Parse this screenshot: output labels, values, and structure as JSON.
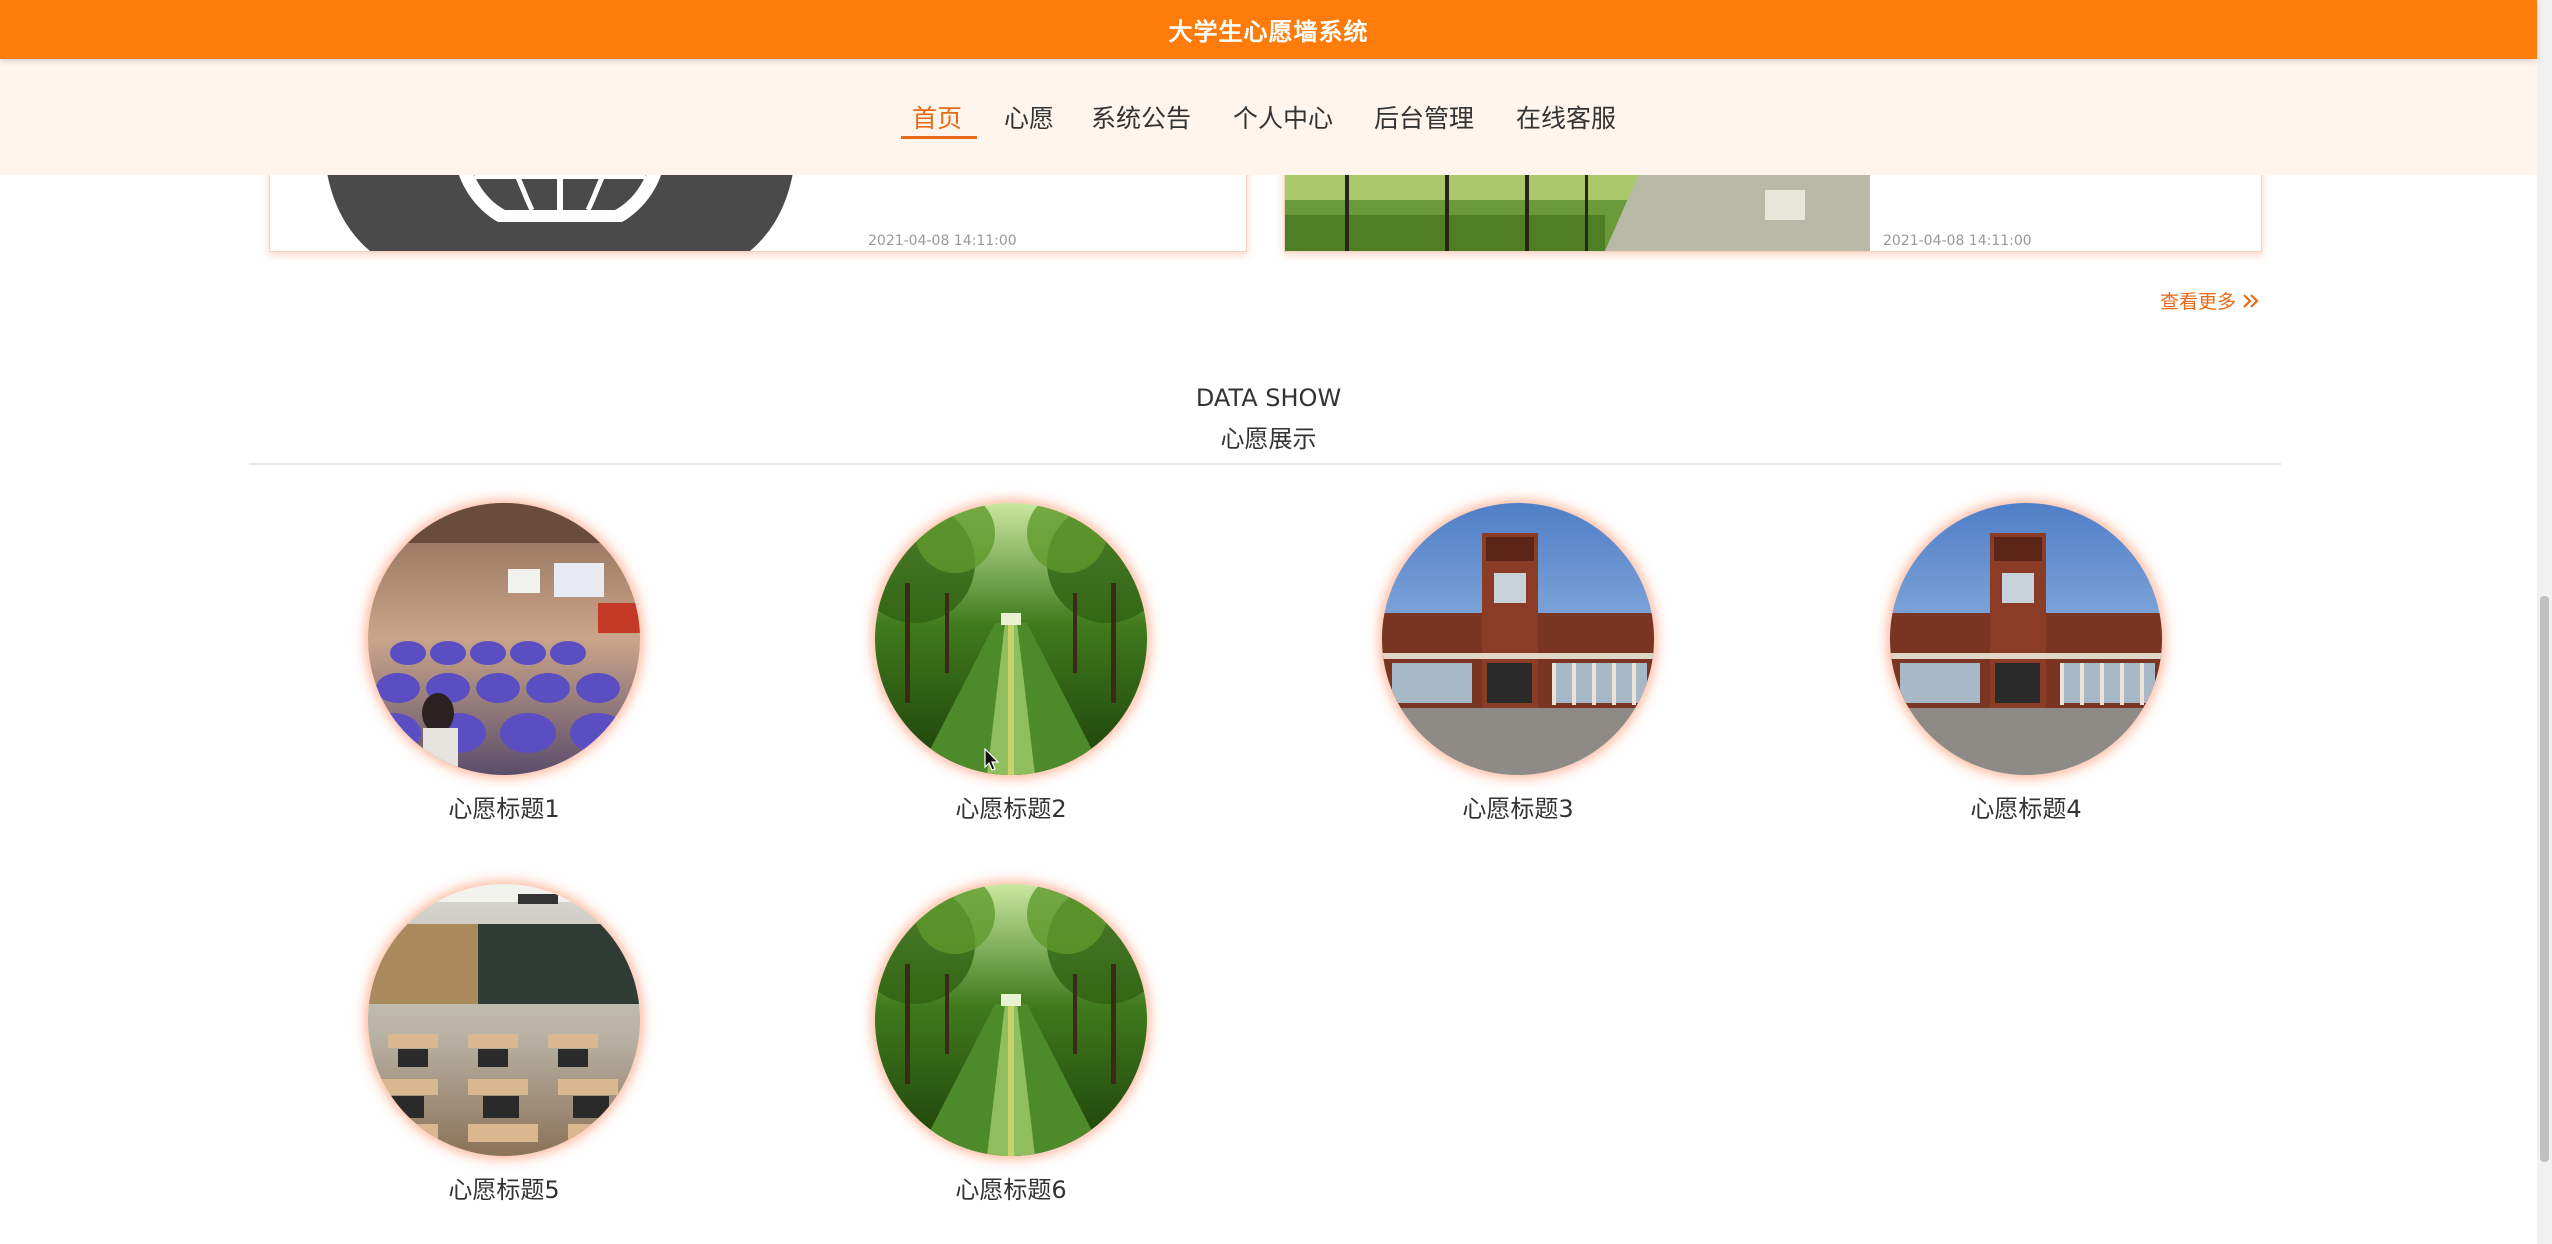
{
  "app": {
    "title": "大学生心愿墙系统"
  },
  "nav": {
    "items": [
      {
        "label": "首页",
        "active": true
      },
      {
        "label": "心愿",
        "active": false
      },
      {
        "label": "系统公告",
        "active": false
      },
      {
        "label": "个人中心",
        "active": false
      },
      {
        "label": "后台管理",
        "active": false
      },
      {
        "label": "在线客服",
        "active": false
      }
    ]
  },
  "news": {
    "cards": [
      {
        "date": "2021-04-08 14:11:00",
        "image": "globe-logo-image"
      },
      {
        "date": "2021-04-08 14:11:00",
        "image": "campus-path-image"
      }
    ],
    "more_label": "查看更多",
    "more_icon": "double-chevron-right-icon"
  },
  "section": {
    "title_en": "DATA SHOW",
    "title_cn": "心愿展示"
  },
  "wishes": [
    {
      "title": "心愿标题1",
      "image": "lecture-hall-image"
    },
    {
      "title": "心愿标题2",
      "image": "tree-lined-path-image"
    },
    {
      "title": "心愿标题3",
      "image": "campus-building-image"
    },
    {
      "title": "心愿标题4",
      "image": "campus-building-image"
    },
    {
      "title": "心愿标题5",
      "image": "classroom-image"
    },
    {
      "title": "心愿标题6",
      "image": "tree-lined-path-image"
    }
  ],
  "colors": {
    "brand": "#ff7b0a",
    "accent": "#e96a16",
    "nav_background": "#fff5ec"
  }
}
